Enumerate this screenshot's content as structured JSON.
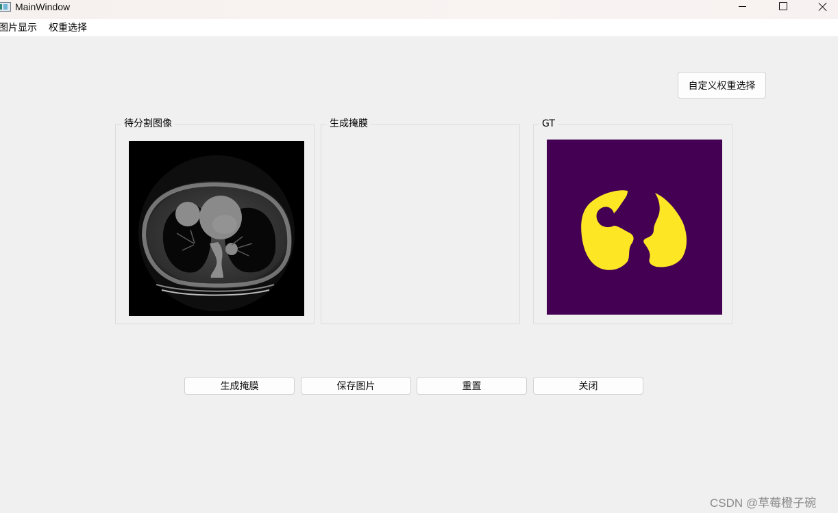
{
  "window": {
    "title": "MainWindow"
  },
  "menu": [
    "图片显示",
    "权重选择"
  ],
  "buttons": {
    "custom_weight": "自定义权重选择",
    "generate_mask": "生成掩膜",
    "save_image": "保存图片",
    "reset": "重置",
    "close": "关闭"
  },
  "panels": {
    "input": {
      "title": "待分割图像"
    },
    "mask": {
      "title": "生成掩膜"
    },
    "gt": {
      "title": "GT"
    }
  },
  "colors": {
    "gt_background": "#440154",
    "gt_lung": "#fde725"
  },
  "watermark": "CSDN @草莓橙子碗"
}
